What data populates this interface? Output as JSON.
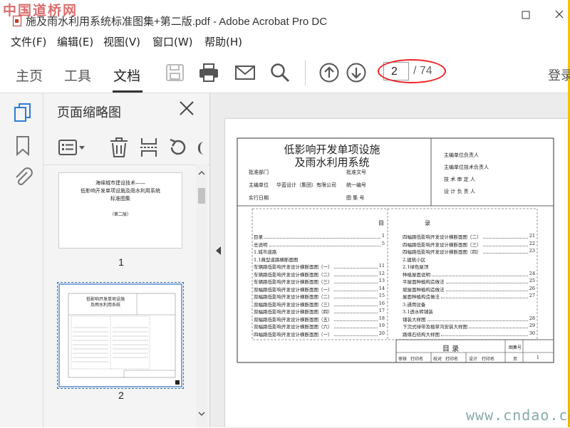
{
  "window": {
    "watermark": "中国道桥网",
    "title": "施及雨水利用系统标准图集+第二版.pdf - Adobe Acrobat Pro DC"
  },
  "menu": [
    "文件(F)",
    "编辑(E)",
    "视图(V)",
    "窗口(W)",
    "帮助(H)"
  ],
  "toolbar": {
    "tabs": [
      "主页",
      "工具",
      "文档"
    ],
    "active_tab": "文档",
    "current_page": "2",
    "total_pages": "/ 74",
    "login": "登录",
    "icons": [
      "save-icon",
      "print-icon",
      "email-icon",
      "search-icon",
      "page-up-icon",
      "page-down-icon"
    ]
  },
  "panel": {
    "title": "页面缩略图",
    "close": "✕",
    "thumbnails": [
      {
        "number": "1",
        "lines": [
          "海绵城市建设技术——",
          "低影响开发单项设施及雨水利用系统",
          "标准图集"
        ],
        "edition": "（第二版）"
      },
      {
        "number": "2",
        "title_line1": "低影响开发单项设施",
        "title_line2": "及雨水利用系统"
      }
    ]
  },
  "page": {
    "title_line1": "低影响开发单项设施",
    "title_line2": "及雨水利用系统",
    "meta_left": [
      {
        "label": "批准部门",
        "value": ""
      },
      {
        "label": "主编单位",
        "value": "华蓝设计（集团）有限公司"
      },
      {
        "label": "实行日期",
        "value": ""
      }
    ],
    "meta_mid": [
      "批准文号",
      "统一编号",
      "图 集 号"
    ],
    "meta_right": [
      "主编单位负责人",
      "主编单位技术负责人",
      "技 术 审 定 人",
      "设 计 负 责 人"
    ],
    "toc_head_left": "目",
    "toc_head_right": "录",
    "toc_left": [
      {
        "text": "目录",
        "page": "1"
      },
      {
        "text": "总说明",
        "page": "5"
      },
      {
        "text": "1.城市道路",
        "page": ""
      },
      {
        "text": "1.1典型道路横断面图",
        "page": ""
      },
      {
        "text": "车辆路低影响开发设计横断面图（一）",
        "page": "11"
      },
      {
        "text": "车辆路低影响开发设计横断面图（二）",
        "page": "12"
      },
      {
        "text": "车辆路低影响开发设计横断面图（三）",
        "page": "13"
      },
      {
        "text": "双幅路低影响开发设计横断面图（一）",
        "page": "14"
      },
      {
        "text": "双幅路低影响开发设计横断面图（二）",
        "page": "15"
      },
      {
        "text": "双幅路低影响开发设计横断面图（三）",
        "page": "16"
      },
      {
        "text": "双幅路低影响开发设计横断面图（四）",
        "page": "17"
      },
      {
        "text": "双幅路低影响开发设计横断面图（五）",
        "page": "18"
      },
      {
        "text": "双幅路低影响开发设计横断面图（六）",
        "page": "19"
      },
      {
        "text": "四幅路低影响开发设计横断面图（一）",
        "page": "20"
      }
    ],
    "toc_right": [
      {
        "text": "四幅路低影响开发设计横断面图（二）",
        "page": "21"
      },
      {
        "text": "四幅路低影响开发设计横断面图（三）",
        "page": "22"
      },
      {
        "text": "四幅路低影响开发设计横断面图（四）",
        "page": "23"
      },
      {
        "text": "2.建筑小区",
        "page": ""
      },
      {
        "text": "2.1绿色屋顶",
        "page": ""
      },
      {
        "text": "种植屋面说明",
        "page": "24"
      },
      {
        "text": "平屋面种植构造做法",
        "page": "25"
      },
      {
        "text": "坡屋面种植构造做法",
        "page": "26"
      },
      {
        "text": "屋面种植构造做法",
        "page": "27"
      },
      {
        "text": "3.通用设备",
        "page": ""
      },
      {
        "text": "3.1透水砖铺装",
        "page": ""
      },
      {
        "text": "铺装大样图",
        "page": "28"
      },
      {
        "text": "下沉式绿带及植草沟安装大样图",
        "page": "29"
      },
      {
        "text": "路缘石结构大样图",
        "page": "30"
      }
    ],
    "titleblock_title": "目 录",
    "titleblock_atlas": "图集号",
    "titleblock_roles": [
      "审核",
      "打印名",
      "校对",
      "打印名",
      "设计",
      "打印名",
      "页",
      "1"
    ]
  },
  "watermark_bottom": "www.cndao.com"
}
